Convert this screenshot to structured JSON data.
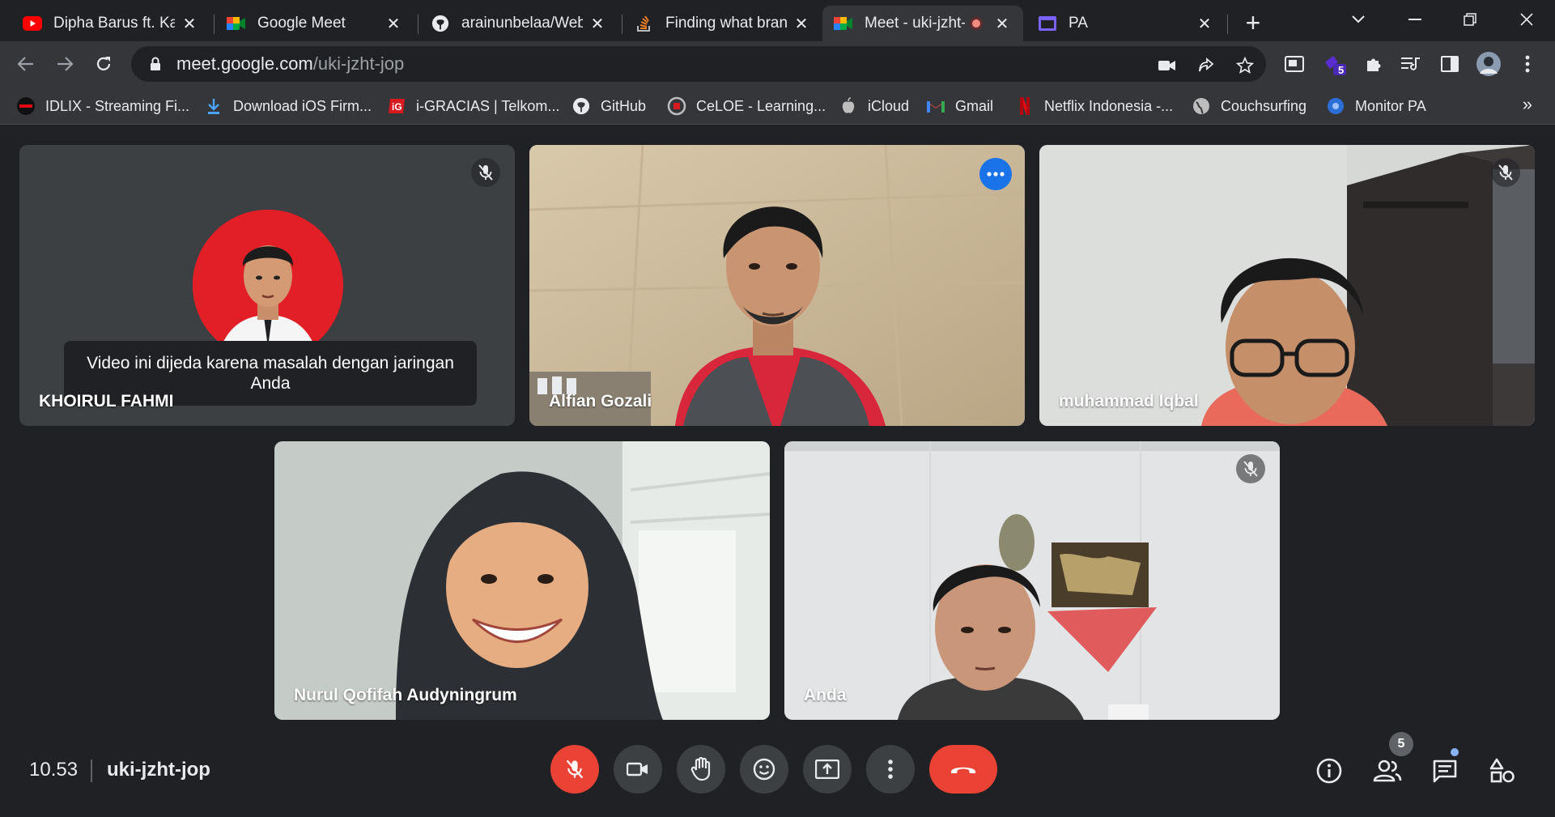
{
  "browser": {
    "tabs": [
      {
        "title": "Dipha Barus ft. Kallula",
        "icon": "youtube-icon"
      },
      {
        "title": "Google Meet",
        "icon": "google-meet-icon"
      },
      {
        "title": "arainunbelaa/Web_",
        "icon": "github-icon"
      },
      {
        "title": "Finding what branch",
        "icon": "stackoverflow-icon"
      },
      {
        "title": "Meet - uki-jzht-jop",
        "icon": "google-meet-icon",
        "active": true,
        "recording": true
      },
      {
        "title": "PA",
        "icon": "calendar-icon"
      }
    ],
    "url": {
      "host": "meet.google.com",
      "path": "/uki-jzht-jop"
    },
    "extensions_badge": "5",
    "bookmarks": [
      {
        "label": "IDLIX - Streaming Fi...",
        "icon": "idlix-icon"
      },
      {
        "label": "Download iOS Firm...",
        "icon": "download-icon"
      },
      {
        "label": "i-GRACIAS | Telkom...",
        "icon": "telkom-icon"
      },
      {
        "label": "GitHub",
        "icon": "github-icon"
      },
      {
        "label": "CeLOE - Learning...",
        "icon": "celoe-icon"
      },
      {
        "label": "iCloud",
        "icon": "apple-icon"
      },
      {
        "label": "Gmail",
        "icon": "gmail-icon"
      },
      {
        "label": "Netflix Indonesia -...",
        "icon": "netflix-icon"
      },
      {
        "label": "Couchsurfing",
        "icon": "globe-icon"
      },
      {
        "label": "Monitor PA",
        "icon": "monitor-icon"
      }
    ]
  },
  "meet": {
    "participants": [
      {
        "name": "KHOIRUL FAHMI",
        "muted": true,
        "notice": "Video ini dijeda karena masalah dengan jaringan Anda"
      },
      {
        "name": "Alfian Gozali",
        "muted": false,
        "speaking": true
      },
      {
        "name": "muhammad Iqbal",
        "muted": true
      },
      {
        "name": "Nurul Qofifah Audyningrum",
        "muted": false
      },
      {
        "name": "Anda",
        "muted": true
      }
    ],
    "time": "10.53",
    "meeting_code": "uki-jzht-jop",
    "people_count": "5"
  }
}
